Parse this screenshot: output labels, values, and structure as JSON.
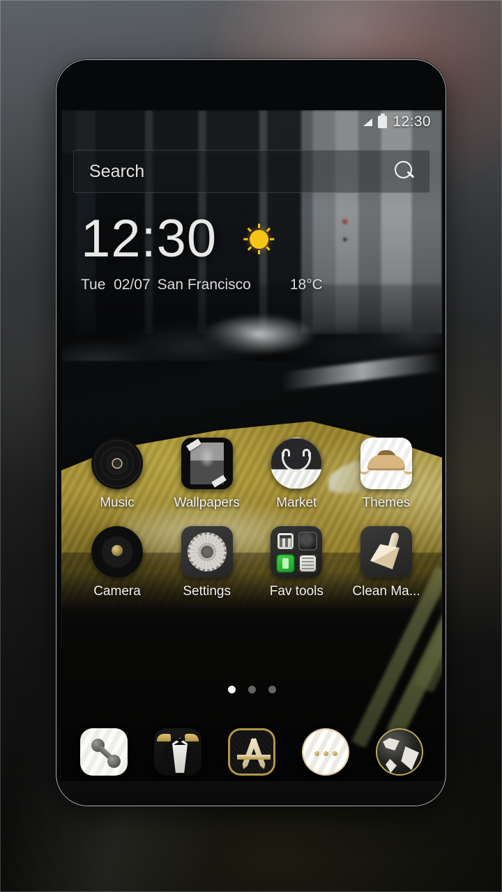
{
  "theme": {
    "accent_gold": "#c9ae3c",
    "status_text_color": "#f3f2ee",
    "label_color": "#f2f2f2",
    "sun_color": "#f7c51a"
  },
  "status_bar": {
    "clock": "12:30",
    "signal_icon": "signal-triangle-icon",
    "battery_icon": "battery-icon"
  },
  "search": {
    "placeholder": "Search",
    "icon": "search-icon"
  },
  "clock_widget": {
    "time": "12:30",
    "date": "Tue  02/07",
    "city": "San Francisco",
    "temperature": "18°C",
    "weather_icon": "sun-icon"
  },
  "app_grid": {
    "rows": [
      {
        "apps": [
          {
            "label": "Music",
            "icon": "vinyl-record-icon"
          },
          {
            "label": "Wallpapers",
            "icon": "photo-frame-icon"
          },
          {
            "label": "Market",
            "icon": "shopping-bag-smile-icon"
          },
          {
            "label": "Themes",
            "icon": "mustache-icon"
          }
        ]
      },
      {
        "apps": [
          {
            "label": "Camera",
            "icon": "camera-lens-icon"
          },
          {
            "label": "Settings",
            "icon": "gear-icon"
          },
          {
            "label": "Fav tools",
            "icon": "folder-icon"
          },
          {
            "label": "Clean Ma...",
            "icon": "brush-icon"
          }
        ]
      }
    ]
  },
  "page_indicator": {
    "total": 3,
    "active_index": 0
  },
  "dock": {
    "items": [
      {
        "name": "phone",
        "icon": "phone-handset-icon"
      },
      {
        "name": "contacts",
        "icon": "tuxedo-icon"
      },
      {
        "name": "app-drawer",
        "icon": "app-drawer-a-icon"
      },
      {
        "name": "messaging",
        "icon": "button-dots-icon"
      },
      {
        "name": "browser",
        "icon": "globe-icon"
      }
    ]
  }
}
